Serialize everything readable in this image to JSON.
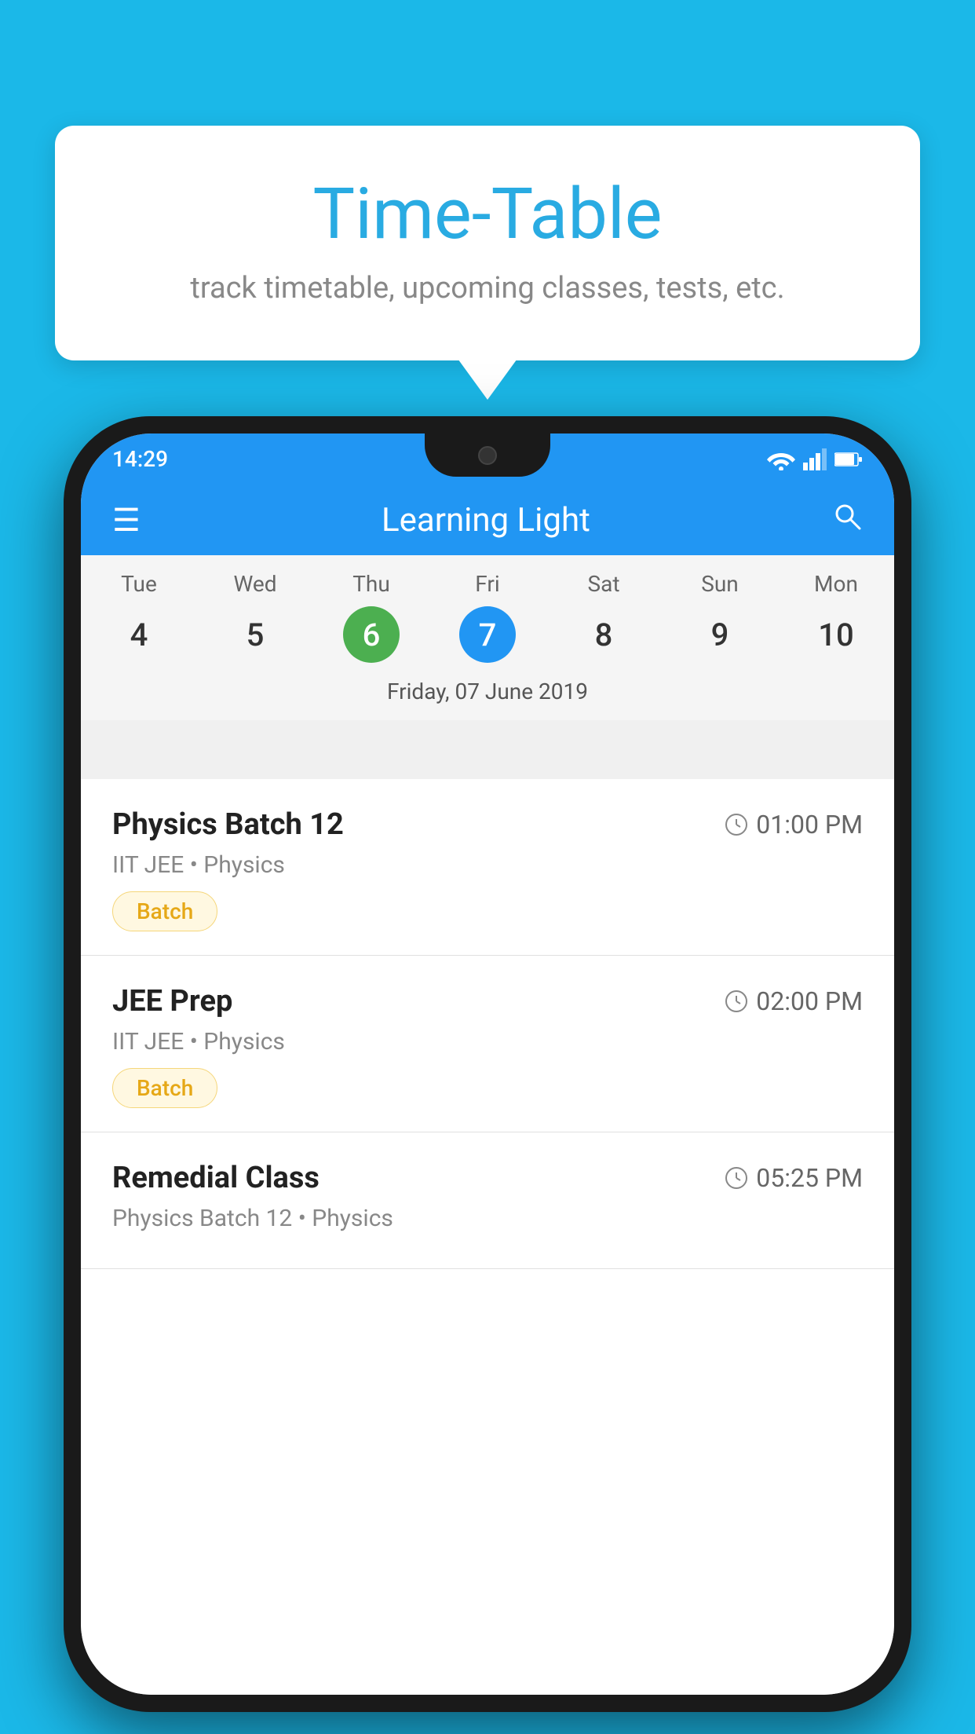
{
  "background_color": "#1BB8E8",
  "tooltip": {
    "title": "Time-Table",
    "subtitle": "track timetable, upcoming classes, tests, etc."
  },
  "phone": {
    "status_bar": {
      "time": "14:29"
    },
    "header": {
      "title": "Learning Light",
      "menu_icon": "≡",
      "search_icon": "🔍"
    },
    "calendar": {
      "days": [
        {
          "label": "Tue",
          "num": "4",
          "state": "normal"
        },
        {
          "label": "Wed",
          "num": "5",
          "state": "normal"
        },
        {
          "label": "Thu",
          "num": "6",
          "state": "today"
        },
        {
          "label": "Fri",
          "num": "7",
          "state": "selected"
        },
        {
          "label": "Sat",
          "num": "8",
          "state": "normal"
        },
        {
          "label": "Sun",
          "num": "9",
          "state": "normal"
        },
        {
          "label": "Mon",
          "num": "10",
          "state": "normal"
        }
      ],
      "selected_date_label": "Friday, 07 June 2019"
    },
    "schedule_items": [
      {
        "name": "Physics Batch 12",
        "time": "01:00 PM",
        "meta": "IIT JEE • Physics",
        "tag": "Batch"
      },
      {
        "name": "JEE Prep",
        "time": "02:00 PM",
        "meta": "IIT JEE • Physics",
        "tag": "Batch"
      },
      {
        "name": "Remedial Class",
        "time": "05:25 PM",
        "meta": "Physics Batch 12 • Physics",
        "tag": ""
      }
    ]
  }
}
